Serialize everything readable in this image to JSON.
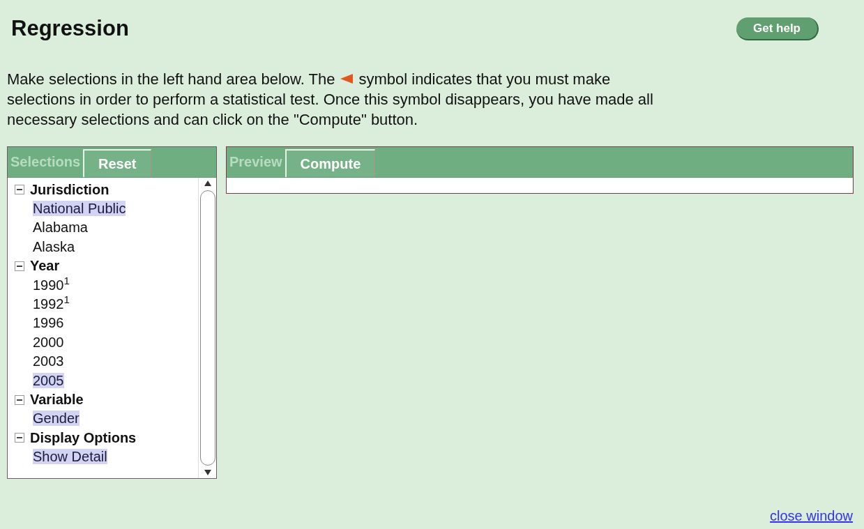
{
  "title": "Regression",
  "help_button": "Get help",
  "intro": {
    "before": "Make selections in the left hand area below. The",
    "after": "symbol indicates that you must make",
    "lines": [
      "selections in order to perform a statistical test. Once this symbol disappears, you have made all",
      "necessary selections and can click on the \"Compute\" button."
    ]
  },
  "selections_panel": {
    "tabs": [
      {
        "label": "Selections",
        "selected": false
      },
      {
        "label": "Reset",
        "selected": true
      }
    ],
    "tree": [
      {
        "label": "Jurisdiction",
        "expanded": true,
        "children": [
          {
            "label": "National Public",
            "selected": true
          },
          {
            "label": "Alabama",
            "selected": false
          },
          {
            "label": "Alaska",
            "selected": false
          }
        ]
      },
      {
        "label": "Year",
        "expanded": true,
        "children": [
          {
            "label": "1990$^{1}$",
            "selected": false
          },
          {
            "label": "1992$^{1}$",
            "selected": false
          },
          {
            "label": "1996",
            "selected": false
          },
          {
            "label": "2000",
            "selected": false
          },
          {
            "label": "2003",
            "selected": false
          },
          {
            "label": "2005",
            "selected": true
          }
        ]
      },
      {
        "label": "Variable",
        "expanded": true,
        "children": [
          {
            "label": "Gender",
            "selected": true
          }
        ]
      },
      {
        "label": "Display Options",
        "expanded": true,
        "children": [
          {
            "label": "Show Detail",
            "selected": true
          }
        ]
      }
    ]
  },
  "results_panel": {
    "tabs": [
      {
        "label": "Preview",
        "selected": false
      },
      {
        "label": "Compute",
        "selected": true
      }
    ]
  },
  "close_link": "close window"
}
